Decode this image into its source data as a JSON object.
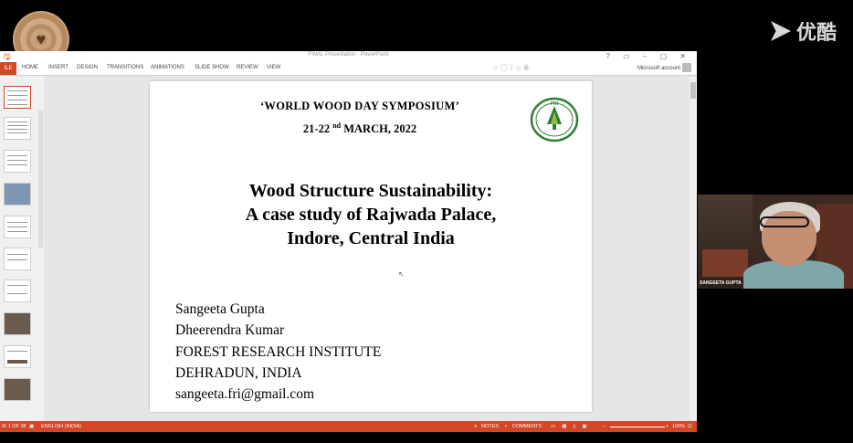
{
  "overlay": {
    "brand": "优酷"
  },
  "window": {
    "title": "FINAL Presentation - PowerPoint",
    "account": "Microsoft account"
  },
  "ribbon": {
    "file_tab": "ILE",
    "tabs": [
      "HOME",
      "INSERT",
      "DESIGN",
      "TRANSITIONS",
      "ANIMATIONS",
      "SLIDE SHOW",
      "REVIEW",
      "VIEW"
    ]
  },
  "slide": {
    "symposium": "‘WORLD WOOD DAY SYMPOSIUM’",
    "date_pre": "21-22 ",
    "date_sup": "nd",
    "date_post": " MARCH, 2022",
    "title_line1": "Wood Structure Sustainability:",
    "title_line2": "A case study of Rajwada Palace,",
    "title_line3": "Indore, Central India",
    "author1": "Sangeeta Gupta",
    "author2": "Dheerendra Kumar",
    "institute": "FOREST RESEARCH INSTITUTE",
    "location": "DEHRADUN, INDIA",
    "email": "sangeeta.fri@gmail.com",
    "logo_text": "FRI"
  },
  "statusbar": {
    "slide_counter": "IE 1 OF 38",
    "language": "ENGLISH (INDIA)",
    "notes": "NOTES",
    "comments": "COMMENTS",
    "zoom": "100%"
  },
  "participant": {
    "name": "SANGEETA GUPTA"
  },
  "colors": {
    "accent": "#d24726",
    "logo_green": "#2e7d32"
  }
}
